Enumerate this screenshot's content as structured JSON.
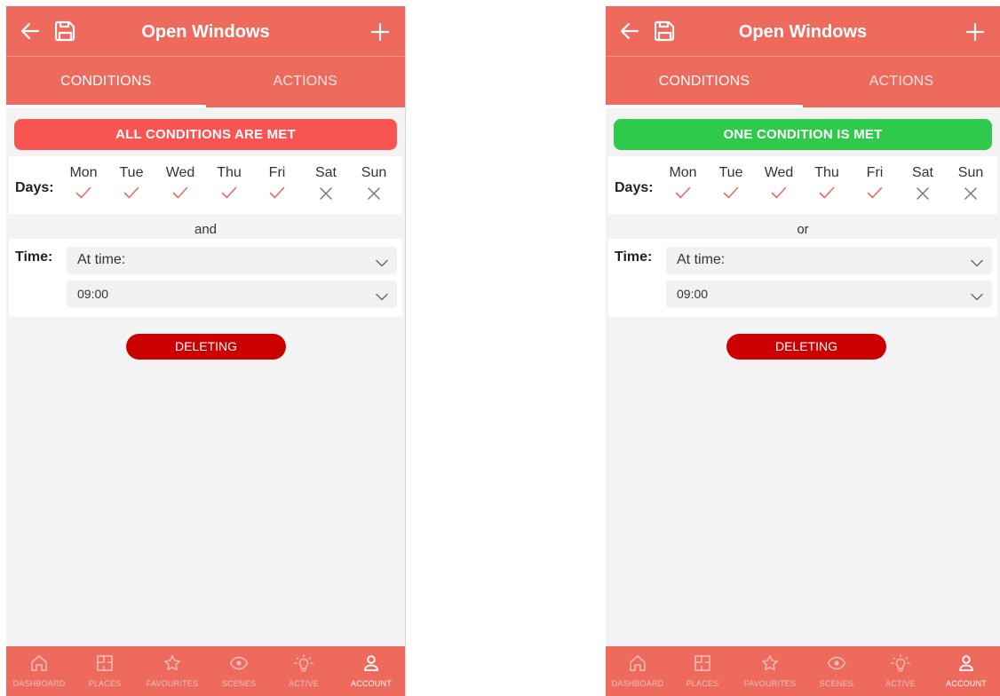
{
  "colors": {
    "header": "#ee6a5d",
    "all_met_banner": "#f85452",
    "one_met_banner": "#2fca4c",
    "delete_button": "#cc0000",
    "check": "#ee6a5d",
    "cross": "#777777"
  },
  "left": {
    "header": {
      "title": "Open Windows",
      "back_icon": "arrow-left-icon",
      "save_icon": "save-icon",
      "add_icon": "plus-icon"
    },
    "tabs": [
      {
        "label": "CONDITIONS",
        "active": true
      },
      {
        "label": "ACTIONS",
        "active": false
      }
    ],
    "banner": "ALL CONDITIONS ARE MET",
    "days_label": "Days:",
    "days": [
      {
        "name": "Mon",
        "selected": true
      },
      {
        "name": "Tue",
        "selected": true
      },
      {
        "name": "Wed",
        "selected": true
      },
      {
        "name": "Thu",
        "selected": true
      },
      {
        "name": "Fri",
        "selected": true
      },
      {
        "name": "Sat",
        "selected": false
      },
      {
        "name": "Sun",
        "selected": false
      }
    ],
    "joiner": "and",
    "time_label": "Time:",
    "time_mode": "At time:",
    "time_value": "09:00",
    "delete_label": "DELETING",
    "nav": [
      {
        "label": "DASHBOARD",
        "icon": "home-icon",
        "active": false
      },
      {
        "label": "PLACES",
        "icon": "floorplan-icon",
        "active": false
      },
      {
        "label": "FAVOURITES",
        "icon": "star-icon",
        "active": false
      },
      {
        "label": "SCENES",
        "icon": "eye-icon",
        "active": false
      },
      {
        "label": "ACTIVE",
        "icon": "bulb-icon",
        "active": false
      },
      {
        "label": "ACCOUNT",
        "icon": "user-icon",
        "active": true
      }
    ]
  },
  "right": {
    "header": {
      "title": "Open Windows",
      "back_icon": "arrow-left-icon",
      "save_icon": "save-icon",
      "add_icon": "plus-icon"
    },
    "tabs": [
      {
        "label": "CONDITIONS",
        "active": true
      },
      {
        "label": "ACTIONS",
        "active": false
      }
    ],
    "banner": "ONE CONDITION IS MET",
    "days_label": "Days:",
    "days": [
      {
        "name": "Mon",
        "selected": true
      },
      {
        "name": "Tue",
        "selected": true
      },
      {
        "name": "Wed",
        "selected": true
      },
      {
        "name": "Thu",
        "selected": true
      },
      {
        "name": "Fri",
        "selected": true
      },
      {
        "name": "Sat",
        "selected": false
      },
      {
        "name": "Sun",
        "selected": false
      }
    ],
    "joiner": "or",
    "time_label": "Time:",
    "time_mode": "At time:",
    "time_value": "09:00",
    "delete_label": "DELETING",
    "nav": [
      {
        "label": "DASHBOARD",
        "icon": "home-icon",
        "active": false
      },
      {
        "label": "PLACES",
        "icon": "floorplan-icon",
        "active": false
      },
      {
        "label": "FAVOURITES",
        "icon": "star-icon",
        "active": false
      },
      {
        "label": "SCENES",
        "icon": "eye-icon",
        "active": false
      },
      {
        "label": "ACTIVE",
        "icon": "bulb-icon",
        "active": false
      },
      {
        "label": "ACCOUNT",
        "icon": "user-icon",
        "active": true
      }
    ]
  }
}
